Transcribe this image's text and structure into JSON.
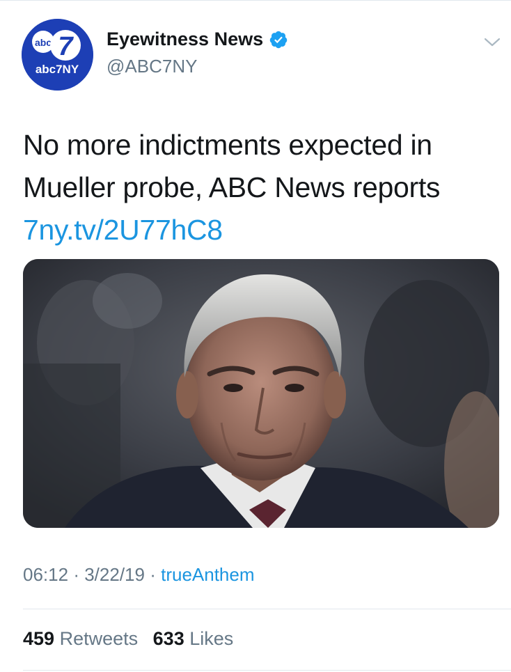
{
  "author": {
    "display_name": "Eyewitness News",
    "handle": "@ABC7NY",
    "verified": true,
    "avatar_icon": "abc7ny-logo",
    "avatar_text_small": "abc",
    "avatar_text_big": "abc7NY",
    "avatar_number": "7"
  },
  "tweet": {
    "text": "No more indictments expected in Mueller probe, ABC News reports",
    "link": "7ny.tv/2U77hC8"
  },
  "meta": {
    "time": "06:12",
    "date": "3/22/19",
    "separator": "·",
    "source": "trueAnthem"
  },
  "stats": {
    "retweets_count": "459",
    "retweets_label": "Retweets",
    "likes_count": "633",
    "likes_label": "Likes"
  },
  "colors": {
    "link": "#1b95e0",
    "secondary_text": "#657786",
    "primary_text": "#14171a",
    "avatar_bg": "#1d3fb5",
    "verified_badge": "#1da1f2"
  }
}
